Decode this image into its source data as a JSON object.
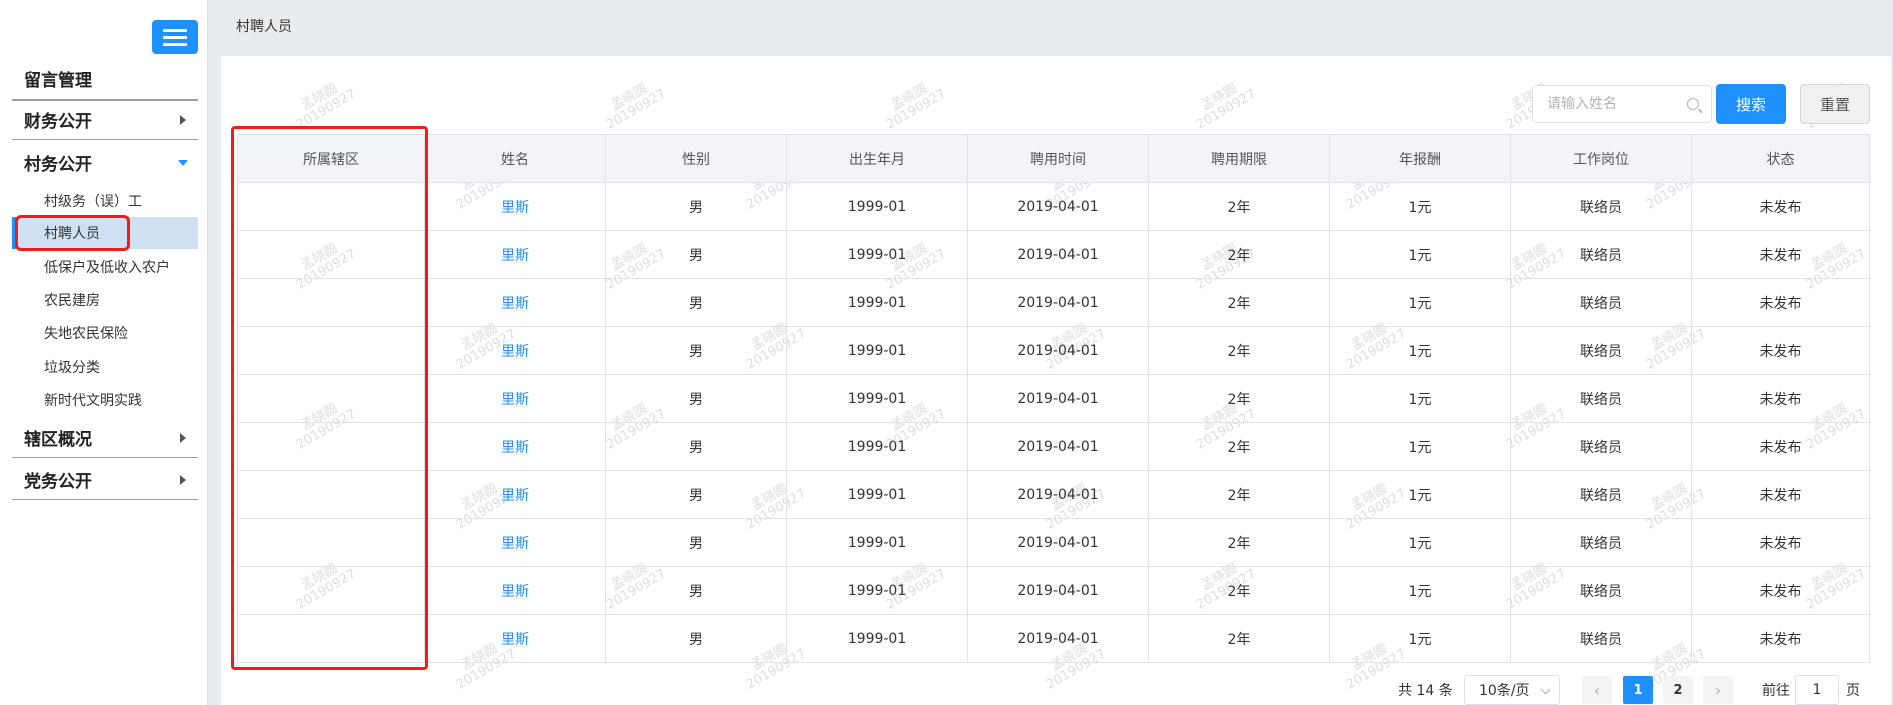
{
  "sidebar": {
    "sections": [
      {
        "label": "留言管理"
      },
      {
        "label": "财务公开"
      },
      {
        "label": "村务公开"
      },
      {
        "label": "辖区概况"
      },
      {
        "label": "党务公开"
      }
    ],
    "subitems": [
      {
        "label": "村级务（误）工"
      },
      {
        "label": "村聘人员"
      },
      {
        "label": "低保户及低收入农户"
      },
      {
        "label": "农民建房"
      },
      {
        "label": "失地农民保险"
      },
      {
        "label": "垃圾分类"
      },
      {
        "label": "新时代文明实践"
      }
    ]
  },
  "breadcrumb": {
    "title": "村聘人员"
  },
  "search": {
    "placeholder": "请输入姓名",
    "search_label": "搜索",
    "reset_label": "重置"
  },
  "table": {
    "headers": [
      "所属辖区",
      "姓名",
      "性别",
      "出生年月",
      "聘用时间",
      "聘用期限",
      "年报酬",
      "工作岗位",
      "状态"
    ],
    "rows": [
      [
        "",
        "里斯",
        "男",
        "1999-01",
        "2019-04-01",
        "2年",
        "1元",
        "联络员",
        "未发布"
      ],
      [
        "",
        "里斯",
        "男",
        "1999-01",
        "2019-04-01",
        "2年",
        "1元",
        "联络员",
        "未发布"
      ],
      [
        "",
        "里斯",
        "男",
        "1999-01",
        "2019-04-01",
        "2年",
        "1元",
        "联络员",
        "未发布"
      ],
      [
        "",
        "里斯",
        "男",
        "1999-01",
        "2019-04-01",
        "2年",
        "1元",
        "联络员",
        "未发布"
      ],
      [
        "",
        "里斯",
        "男",
        "1999-01",
        "2019-04-01",
        "2年",
        "1元",
        "联络员",
        "未发布"
      ],
      [
        "",
        "里斯",
        "男",
        "1999-01",
        "2019-04-01",
        "2年",
        "1元",
        "联络员",
        "未发布"
      ],
      [
        "",
        "里斯",
        "男",
        "1999-01",
        "2019-04-01",
        "2年",
        "1元",
        "联络员",
        "未发布"
      ],
      [
        "",
        "里斯",
        "男",
        "1999-01",
        "2019-04-01",
        "2年",
        "1元",
        "联络员",
        "未发布"
      ],
      [
        "",
        "里斯",
        "男",
        "1999-01",
        "2019-04-01",
        "2年",
        "1元",
        "联络员",
        "未发布"
      ],
      [
        "",
        "里斯",
        "男",
        "1999-01",
        "2019-04-01",
        "2年",
        "1元",
        "联络员",
        "未发布"
      ]
    ]
  },
  "pagination": {
    "total": "共 14 条",
    "page_size": "10条/页",
    "prev": "‹",
    "next": "›",
    "pages": [
      "1",
      "2"
    ],
    "goto_label": "前往",
    "goto_value": "1",
    "page_suffix": "页"
  },
  "watermark": {
    "name": "孟晓圆",
    "date": "20190927"
  },
  "colors": {
    "accent": "#1e90ff",
    "highlight": "#ee1c1c"
  }
}
